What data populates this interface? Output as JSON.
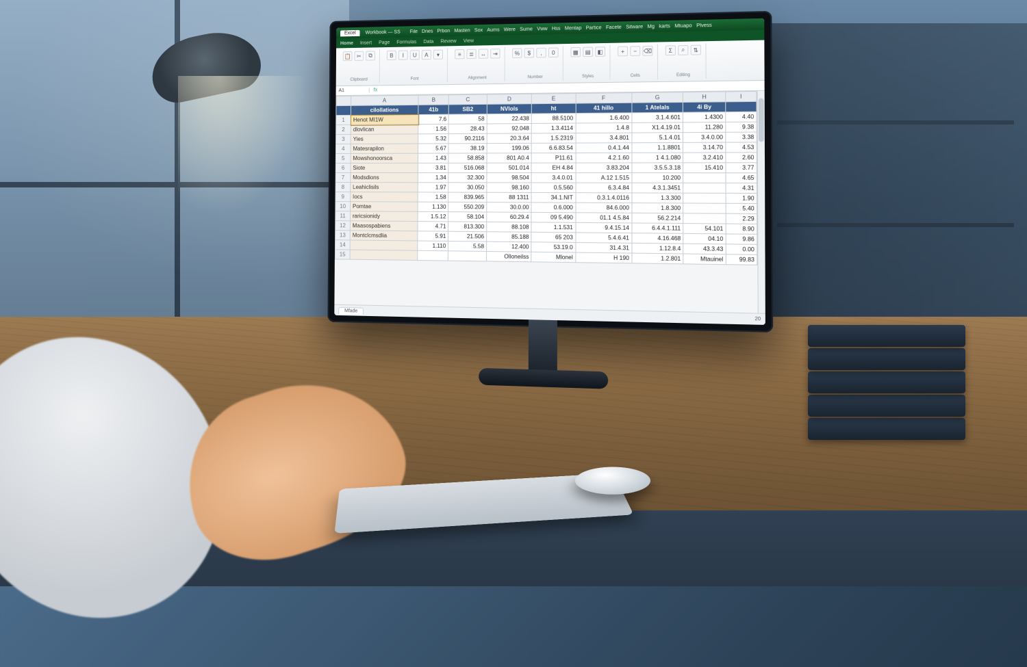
{
  "app": {
    "title": "Excel",
    "doc": "Workbook — SS",
    "menus": [
      "File",
      "Dnes",
      "Prbon",
      "Masten",
      "Sox",
      "Aums",
      "Were",
      "Sume",
      "Vww",
      "Hss",
      "Mentap",
      "Partice",
      "Facete",
      "Sitware",
      "Mg",
      "karts",
      "Mtuapo",
      "Plvess"
    ]
  },
  "ribbon_tabs": [
    "Home",
    "Insert",
    "Page",
    "Formulas",
    "Data",
    "Review",
    "View"
  ],
  "ribbon_groups": [
    {
      "label": "Clipboard",
      "icons": [
        "📋",
        "✂",
        "⧉"
      ]
    },
    {
      "label": "Font",
      "icons": [
        "B",
        "I",
        "U",
        "A",
        "▾"
      ]
    },
    {
      "label": "Alignment",
      "icons": [
        "≡",
        "≣",
        "↔",
        "⇥"
      ]
    },
    {
      "label": "Number",
      "icons": [
        "%",
        "$",
        ",",
        "0"
      ]
    },
    {
      "label": "Styles",
      "icons": [
        "▦",
        "▤",
        "◧"
      ]
    },
    {
      "label": "Cells",
      "icons": [
        "+",
        "−",
        "⌫"
      ]
    },
    {
      "label": "Editing",
      "icons": [
        "Σ",
        "⌕",
        "⇅"
      ]
    }
  ],
  "formula": {
    "namebox": "A1",
    "fx": "fx",
    "value": ""
  },
  "col_letters": [
    "",
    "A",
    "B",
    "C",
    "D",
    "E",
    "F",
    "G",
    "H",
    "I"
  ],
  "headers": [
    "cilollations",
    "41b",
    "SB2",
    "NVlols",
    "ht",
    "41 hillo",
    "1 Atelals",
    "4i By",
    ""
  ],
  "rows": [
    {
      "n": 1,
      "label": "Henot MI1W",
      "c": [
        "7.6",
        "58",
        "22.438",
        "88.5100",
        "1.6.400",
        "3.1.4.601",
        "1.4300",
        "4.40"
      ]
    },
    {
      "n": 2,
      "label": "dlovlican",
      "c": [
        "1.56",
        "28.43",
        "92.048",
        "1.3.4114",
        "1.4.8",
        "X1.4.19.01",
        "11.280",
        "9.38"
      ]
    },
    {
      "n": 3,
      "label": "Yies",
      "c": [
        "5.32",
        "90.2116",
        "20.3.64",
        "1.5.2319",
        "3.4.801",
        "5.1.4.01",
        "3.4.0.00",
        "3.38"
      ]
    },
    {
      "n": 4,
      "label": "Matesrapilon",
      "c": [
        "5.67",
        "38.19",
        "199.06",
        "6.6.83.54",
        "0.4.1.44",
        "1.1.8801",
        "3.14.70",
        "4.53"
      ]
    },
    {
      "n": 5,
      "label": "Mowshonoorsca",
      "c": [
        "1.43",
        "58.858",
        "801 A0.4",
        "P11.61",
        "4.2.1.60",
        "1 4.1.080",
        "3.2.410",
        "2.60"
      ]
    },
    {
      "n": 6,
      "label": "Siote",
      "c": [
        "3.81",
        "516.068",
        "501.014",
        "EH 4.84",
        "3.83.204",
        "3.5.5.3.18",
        "15.410",
        "3.77"
      ]
    },
    {
      "n": 7,
      "label": "Modsdions",
      "c": [
        "1.34",
        "32.300",
        "98.504",
        "3.4.0.01",
        "A.12 1.515",
        "10.200",
        "",
        "4.65"
      ]
    },
    {
      "n": 8,
      "label": "Leahiclisils",
      "c": [
        "1.97",
        "30.050",
        "98.160",
        "0.5.560",
        "6.3.4.84",
        "4.3.1.3451",
        "",
        "4.31"
      ]
    },
    {
      "n": 9,
      "label": "Iocs",
      "c": [
        "1.58",
        "839.965",
        "88 1311",
        "34.1.NIT",
        "0.3.1.4.0116",
        "1.3.300",
        "",
        "1.90"
      ]
    },
    {
      "n": 10,
      "label": "Pomtae",
      "c": [
        "1.130",
        "550.209",
        "30.0.00",
        "0.6.000",
        "84.6.000",
        "1.8.300",
        "",
        "5.40"
      ]
    },
    {
      "n": 11,
      "label": "raricsionidy",
      "c": [
        "1.5.12",
        "58.104",
        "60.29.4",
        "09 5.490",
        "01.1 4.5.84",
        "56.2.214",
        "",
        "2.29"
      ]
    },
    {
      "n": 12,
      "label": "Maasospabiens",
      "c": [
        "4.71",
        "813.300",
        "88.108",
        "1.1.531",
        "9.4.15.14",
        "6.4.4.1.111",
        "54.101",
        "8.90"
      ]
    },
    {
      "n": 13,
      "label": "Montclcmsdlia",
      "c": [
        "5.91",
        "21.506",
        "85.188",
        "65 203",
        "5.4.6.41",
        "4.16.468",
        "04.10",
        "9.86"
      ]
    },
    {
      "n": 14,
      "label": "",
      "c": [
        "1.110",
        "5.58",
        "12.400",
        "53.19.0",
        "31.4.31",
        "1.12.8.4",
        "43.3.43",
        "0.00"
      ]
    },
    {
      "n": 15,
      "label": "",
      "c": [
        "",
        "",
        "Olloneilss",
        "Mlonel",
        "H 190",
        "1.2.801",
        "Mtauinel",
        "99.83"
      ]
    }
  ],
  "status": {
    "sheet": "Mfade",
    "zoom": "20"
  }
}
